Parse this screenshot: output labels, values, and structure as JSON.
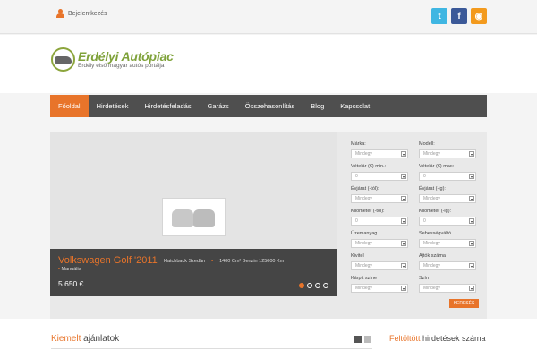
{
  "topbar": {
    "login_label": "Bejelentkezés",
    "social": [
      {
        "name": "twitter-icon",
        "glyph": "t"
      },
      {
        "name": "facebook-icon",
        "glyph": "f"
      },
      {
        "name": "rss-icon",
        "glyph": "◉"
      }
    ]
  },
  "logo": {
    "title": "Erdélyi Autópiac",
    "subtitle": "Erdély első magyar autós portálja"
  },
  "nav": {
    "items": [
      "Főoldal",
      "Hirdetések",
      "Hirdetésfeladás",
      "Garázs",
      "Összehasonlítás",
      "Blog",
      "Kapcsolat"
    ],
    "active_index": 0
  },
  "slider": {
    "title": "Volkswagen Golf '2011",
    "body": "Hatchback Szedán",
    "engine": "1400 Cm³ Benzin 125000 Km",
    "gearbox": "Manuális",
    "price": "5.650 €",
    "slides": 4,
    "active_slide": 0
  },
  "search": {
    "fields": [
      {
        "label": "Márka:",
        "value": "Mindegy"
      },
      {
        "label": "Modell:",
        "value": "Mindegy"
      },
      {
        "label": "Vételár (€) min.:",
        "value": "0"
      },
      {
        "label": "Vételár (€) max:",
        "value": "0"
      },
      {
        "label": "Évjárat (-tól):",
        "value": "Mindegy"
      },
      {
        "label": "Évjárat (-ig):",
        "value": "Mindegy"
      },
      {
        "label": "Kilométer (-tól):",
        "value": "0"
      },
      {
        "label": "Kilométer (-ig):",
        "value": "0"
      },
      {
        "label": "Üzemanyag",
        "value": "Mindegy"
      },
      {
        "label": "Sebességváltó",
        "value": "Mindegy"
      },
      {
        "label": "Kivitel",
        "value": "Mindegy"
      },
      {
        "label": "Ajtók száma",
        "value": "Mindegy"
      },
      {
        "label": "Kárpit színe",
        "value": "Mindegy"
      },
      {
        "label": "Szín",
        "value": "Mindegy"
      }
    ],
    "button": "KERESÉS"
  },
  "featured": {
    "title_highlight": "Kiemelt",
    "title_rest": "ajánlatok"
  },
  "uploaded": {
    "title_highlight": "Feltöltött",
    "title_rest": "hirdetések száma"
  },
  "colors": {
    "accent": "#e8742a",
    "nav_bg": "#4f4f4f",
    "logo_green": "#7fa23a"
  }
}
